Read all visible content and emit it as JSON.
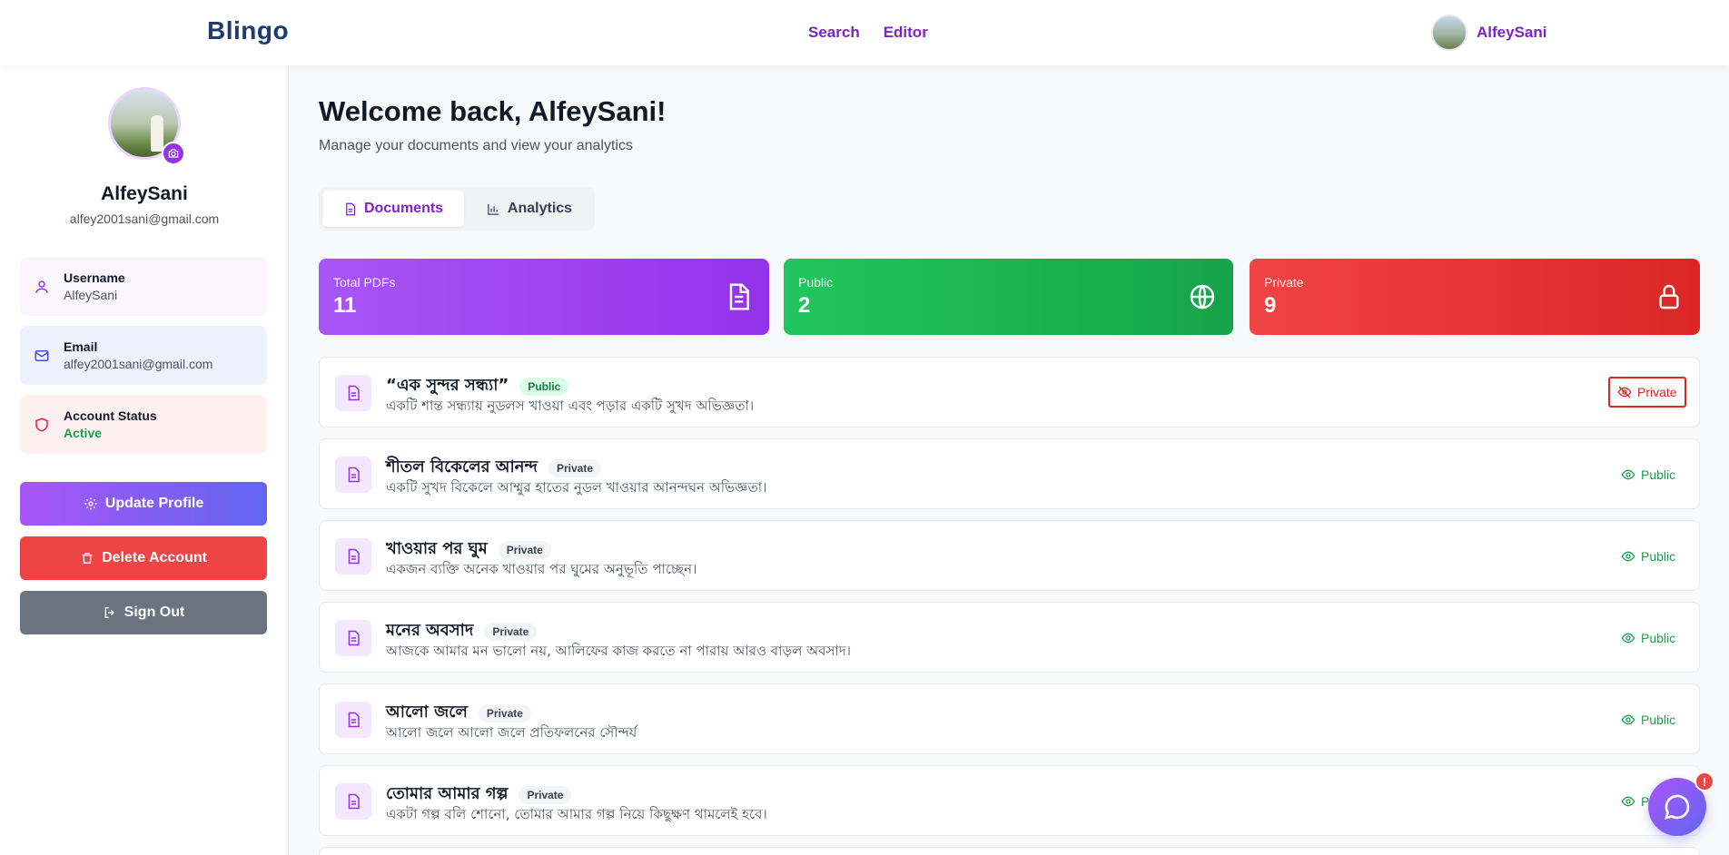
{
  "header": {
    "brand": "Blingo",
    "nav": [
      {
        "label": "Search"
      },
      {
        "label": "Editor"
      }
    ],
    "user_name": "AlfeySani"
  },
  "sidebar": {
    "name": "AlfeySani",
    "email": "alfey2001sani@gmail.com",
    "cards": {
      "username": {
        "label": "Username",
        "value": "AlfeySani"
      },
      "email": {
        "label": "Email",
        "value": "alfey2001sani@gmail.com"
      },
      "status": {
        "label": "Account Status",
        "value": "Active"
      }
    },
    "buttons": {
      "update": "Update Profile",
      "delete": "Delete Account",
      "signout": "Sign Out"
    }
  },
  "main": {
    "welcome": "Welcome back, AlfeySani!",
    "subtitle": "Manage your documents and view your analytics",
    "tabs": [
      {
        "label": "Documents",
        "active": true
      },
      {
        "label": "Analytics",
        "active": false
      }
    ],
    "stats": [
      {
        "label": "Total PDFs",
        "value": "11"
      },
      {
        "label": "Public",
        "value": "2"
      },
      {
        "label": "Private",
        "value": "9"
      }
    ],
    "documents": [
      {
        "title": "“এক সুন্দর সন্ধ্যা”",
        "badge": "Public",
        "desc": "একটি শান্ত সন্ধ্যায় নুডলস খাওয়া এবং পড়ার একটি সুখদ অভিজ্ঞতা।",
        "action": "Private"
      },
      {
        "title": "শীতল বিকেলের আনন্দ",
        "badge": "Private",
        "desc": "একটি সুখদ বিকেলে আম্মুর হাতের নুডল খাওয়ার আনন্দঘন অভিজ্ঞতা।",
        "action": "Public"
      },
      {
        "title": "খাওয়ার পর ঘুম",
        "badge": "Private",
        "desc": "একজন ব্যক্তি অনেক খাওয়ার পর ঘুমের অনুভূতি পাচ্ছেন।",
        "action": "Public"
      },
      {
        "title": "মনের অবসাদ",
        "badge": "Private",
        "desc": "আজকে আমার মন ভালো নয়, আলিফের কাজ করতে না পারায় আরও বাড়ল অবসাদ।",
        "action": "Public"
      },
      {
        "title": "আলো জলে",
        "badge": "Private",
        "desc": "আলো জলে আলো জলে প্রতিফলনের সৌন্দর্য",
        "action": "Public"
      },
      {
        "title": "তোমার আমার গল্প",
        "badge": "Private",
        "desc": "একটা গল্প বলি শোনো, তোমার আমার গল্প নিয়ে কিছুক্ষণ থামলেই হবে।",
        "action": "Public"
      }
    ]
  },
  "chat": {
    "alert": "!"
  },
  "colors": {
    "accent": "#9333ea",
    "public": "#16a34a",
    "private": "#dc2626",
    "brand": "#1e3a6e"
  }
}
